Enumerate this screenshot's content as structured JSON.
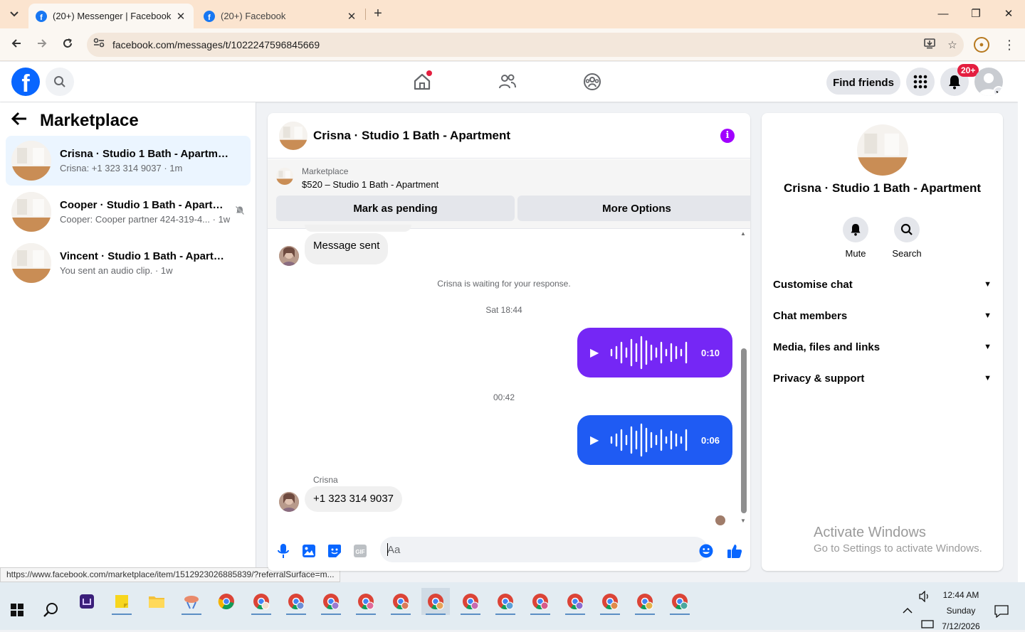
{
  "browser": {
    "tabs": [
      {
        "title": "(20+) Messenger | Facebook",
        "active": true
      },
      {
        "title": "(20+) Facebook",
        "active": false
      }
    ],
    "url": "facebook.com/messages/t/1022247596845669",
    "status_url": "https://www.facebook.com/marketplace/item/1512923026885839/?referralSurface=m..."
  },
  "fbnav": {
    "logo": "f",
    "find_friends": "Find friends",
    "notif_badge": "20+"
  },
  "left": {
    "title": "Marketplace",
    "conversations": [
      {
        "name": "Crisna · Studio 1 Bath - Apartment",
        "snippet": "Crisna: +1 323 314 9037 · 1m",
        "active": true,
        "muted": false
      },
      {
        "name": "Cooper · Studio 1 Bath - Apartm...",
        "snippet": "Cooper: Cooper partner 424-319-4... · 1w",
        "active": false,
        "muted": true
      },
      {
        "name": "Vincent · Studio 1 Bath - Apartment",
        "snippet": "You sent an audio clip. · 1w",
        "active": false,
        "muted": false
      }
    ]
  },
  "chat": {
    "title": "Crisna · Studio 1 Bath - Apartment",
    "marketplace_label": "Marketplace",
    "listing": "$520 – Studio 1 Bath - Apartment",
    "btn_pending": "Mark as pending",
    "btn_more": "More Options",
    "messages": {
      "sent_text": "Message sent",
      "waiting": "Crisna is waiting for your response.",
      "time1": "Sat 18:44",
      "audio1_duration": "0:10",
      "time2": "00:42",
      "audio2_duration": "0:06",
      "sender_name": "Crisna",
      "phone": "+1 323 314 9037"
    },
    "input_placeholder": "Aa",
    "colors": {
      "audio1": "#7527f5",
      "audio2": "#1f5bf3",
      "accent": "#a100ff"
    }
  },
  "right": {
    "name": "Crisna · Studio 1 Bath - Apartment",
    "mute_label": "Mute",
    "search_label": "Search",
    "sections": [
      "Customise chat",
      "Chat members",
      "Media, files and links",
      "Privacy & support"
    ]
  },
  "watermark": {
    "line1": "Activate Windows",
    "line2": "Go to Settings to activate Windows."
  },
  "taskbar": {
    "time": "12:44 AM",
    "day": "Sunday",
    "date": "7/12/2026"
  }
}
